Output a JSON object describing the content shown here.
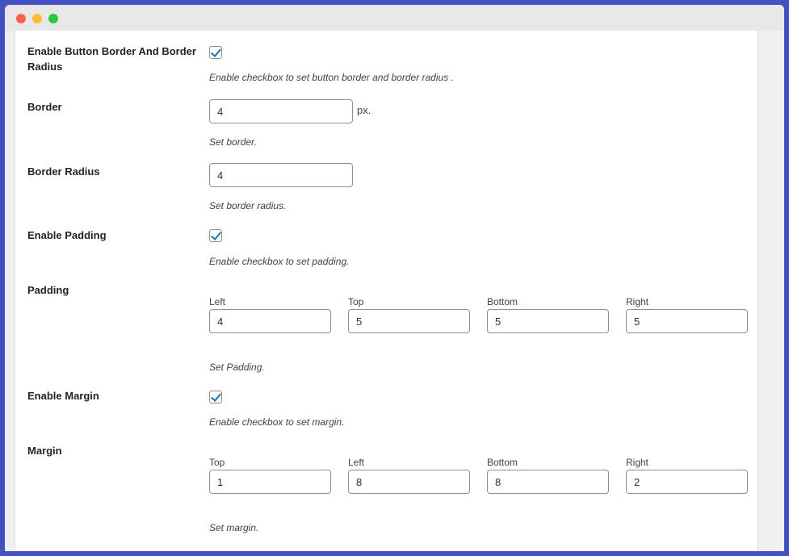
{
  "settings": {
    "enable_border": {
      "label": "Enable Button Border And Border Radius",
      "checked": true,
      "desc": "Enable checkbox to set button border and border radius ."
    },
    "border": {
      "label": "Border",
      "value": "4",
      "unit": "px.",
      "desc": "Set border."
    },
    "border_radius": {
      "label": "Border Radius",
      "value": "4",
      "desc": "Set border radius."
    },
    "enable_padding": {
      "label": "Enable Padding",
      "checked": true,
      "desc": "Enable checkbox to set padding."
    },
    "padding": {
      "label": "Padding",
      "fields": [
        {
          "label": "Left",
          "value": "4"
        },
        {
          "label": "Top",
          "value": "5"
        },
        {
          "label": "Bottom",
          "value": "5"
        },
        {
          "label": "Right",
          "value": "5"
        }
      ],
      "desc": "Set Padding."
    },
    "enable_margin": {
      "label": "Enable Margin",
      "checked": true,
      "desc": "Enable checkbox to set margin."
    },
    "margin": {
      "label": "Margin",
      "fields": [
        {
          "label": "Top",
          "value": "1"
        },
        {
          "label": "Left",
          "value": "8"
        },
        {
          "label": "Bottom",
          "value": "8"
        },
        {
          "label": "Right",
          "value": "2"
        }
      ],
      "desc": "Set margin."
    }
  },
  "colors": {
    "accent": "#2271b1",
    "frame": "#4451c1"
  }
}
